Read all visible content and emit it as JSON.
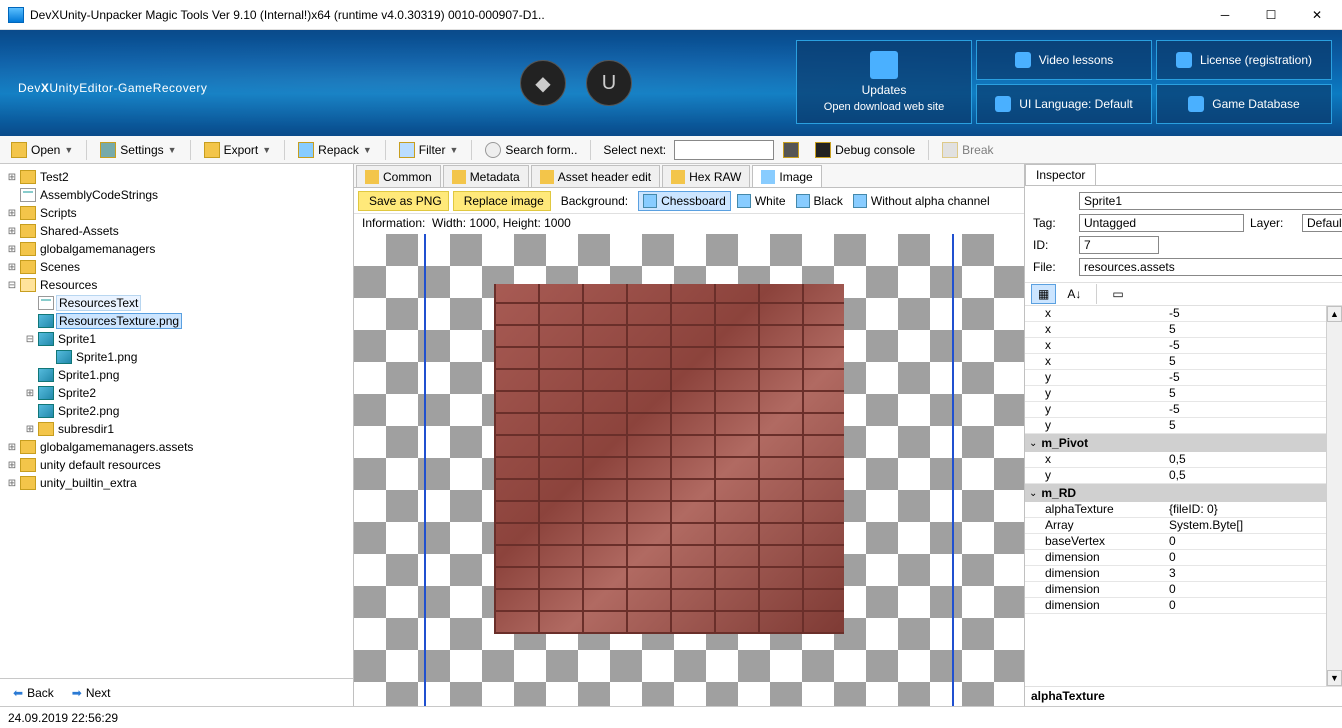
{
  "window": {
    "title": "DevXUnity-Unpacker Magic Tools Ver 9.10 (Internal!)x64 (runtime v4.0.30319) 0010-000907-D1.."
  },
  "banner": {
    "logo_pre": "Dev",
    "logo_x": "X",
    "logo_rest": "UnityEditor-GameRecovery",
    "buttons": {
      "video": "Video lessons",
      "license": "License (registration)",
      "lang": "UI Language: Default",
      "db": "Game Database",
      "updates_title": "Updates",
      "updates_sub": "Open download web site"
    }
  },
  "toolbar": {
    "open": "Open",
    "settings": "Settings",
    "export": "Export",
    "repack": "Repack",
    "filter": "Filter",
    "search": "Search form..",
    "selectnext": "Select next:",
    "debug": "Debug console",
    "break": "Break"
  },
  "tree": [
    {
      "d": 0,
      "e": "+",
      "i": "folder",
      "t": "Test2"
    },
    {
      "d": 0,
      "e": "",
      "i": "page",
      "t": "AssemblyCodeStrings"
    },
    {
      "d": 0,
      "e": "+",
      "i": "folder",
      "t": "Scripts"
    },
    {
      "d": 0,
      "e": "+",
      "i": "folder",
      "t": "Shared-Assets"
    },
    {
      "d": 0,
      "e": "+",
      "i": "folder",
      "t": "globalgamemanagers"
    },
    {
      "d": 0,
      "e": "+",
      "i": "folder",
      "t": "Scenes"
    },
    {
      "d": 0,
      "e": "-",
      "i": "folderopen",
      "t": "Resources"
    },
    {
      "d": 1,
      "e": "",
      "i": "page",
      "t": "ResourcesText",
      "sel": false,
      "hl": true
    },
    {
      "d": 1,
      "e": "",
      "i": "img",
      "t": "ResourcesTexture.png",
      "sel": true
    },
    {
      "d": 1,
      "e": "-",
      "i": "img",
      "t": "Sprite1"
    },
    {
      "d": 2,
      "e": "",
      "i": "img",
      "t": "Sprite1.png"
    },
    {
      "d": 1,
      "e": "",
      "i": "img",
      "t": "Sprite1.png"
    },
    {
      "d": 1,
      "e": "+",
      "i": "img",
      "t": "Sprite2"
    },
    {
      "d": 1,
      "e": "",
      "i": "img",
      "t": "Sprite2.png"
    },
    {
      "d": 1,
      "e": "+",
      "i": "folder",
      "t": "subresdir1"
    },
    {
      "d": 0,
      "e": "+",
      "i": "folder",
      "t": "globalgamemanagers.assets"
    },
    {
      "d": 0,
      "e": "+",
      "i": "folder",
      "t": "unity default resources"
    },
    {
      "d": 0,
      "e": "+",
      "i": "folder",
      "t": "unity_builtin_extra"
    }
  ],
  "nav": {
    "back": "Back",
    "next": "Next"
  },
  "center": {
    "tabs": [
      "Common",
      "Metadata",
      "Asset header edit",
      "Hex RAW",
      "Image"
    ],
    "active_tab": 4,
    "save_png": "Save as PNG",
    "replace": "Replace image",
    "bg_label": "Background:",
    "bg_options": [
      "Chessboard",
      "White",
      "Black",
      "Without alpha channel"
    ],
    "bg_selected": 0,
    "info_label": "Information:",
    "info_value": "Width: 1000, Height: 1000"
  },
  "inspector": {
    "tab": "Inspector",
    "name": "Sprite1",
    "tag_label": "Tag:",
    "tag": "Untagged",
    "layer_label": "Layer:",
    "layer": "Default",
    "id_label": "ID:",
    "id": "7",
    "file_label": "File:",
    "file": "resources.assets",
    "groups": [
      {
        "rows": [
          {
            "n": "x",
            "v": "-5"
          },
          {
            "n": "x",
            "v": "5"
          },
          {
            "n": "x",
            "v": "-5"
          },
          {
            "n": "x",
            "v": "5"
          },
          {
            "n": "y",
            "v": "-5"
          },
          {
            "n": "y",
            "v": "5"
          },
          {
            "n": "y",
            "v": "-5"
          },
          {
            "n": "y",
            "v": "5"
          }
        ]
      },
      {
        "title": "m_Pivot",
        "rows": [
          {
            "n": "x",
            "v": "0,5"
          },
          {
            "n": "y",
            "v": "0,5"
          }
        ]
      },
      {
        "title": "m_RD",
        "rows": [
          {
            "n": "alphaTexture",
            "v": "{fileID: 0}"
          },
          {
            "n": "Array",
            "v": "System.Byte[]"
          },
          {
            "n": "baseVertex",
            "v": "0"
          },
          {
            "n": "dimension",
            "v": "0"
          },
          {
            "n": "dimension",
            "v": "3"
          },
          {
            "n": "dimension",
            "v": "0"
          },
          {
            "n": "dimension",
            "v": "0"
          }
        ]
      }
    ],
    "footer": "alphaTexture"
  },
  "status": {
    "time": "24.09.2019 22:56:29"
  }
}
